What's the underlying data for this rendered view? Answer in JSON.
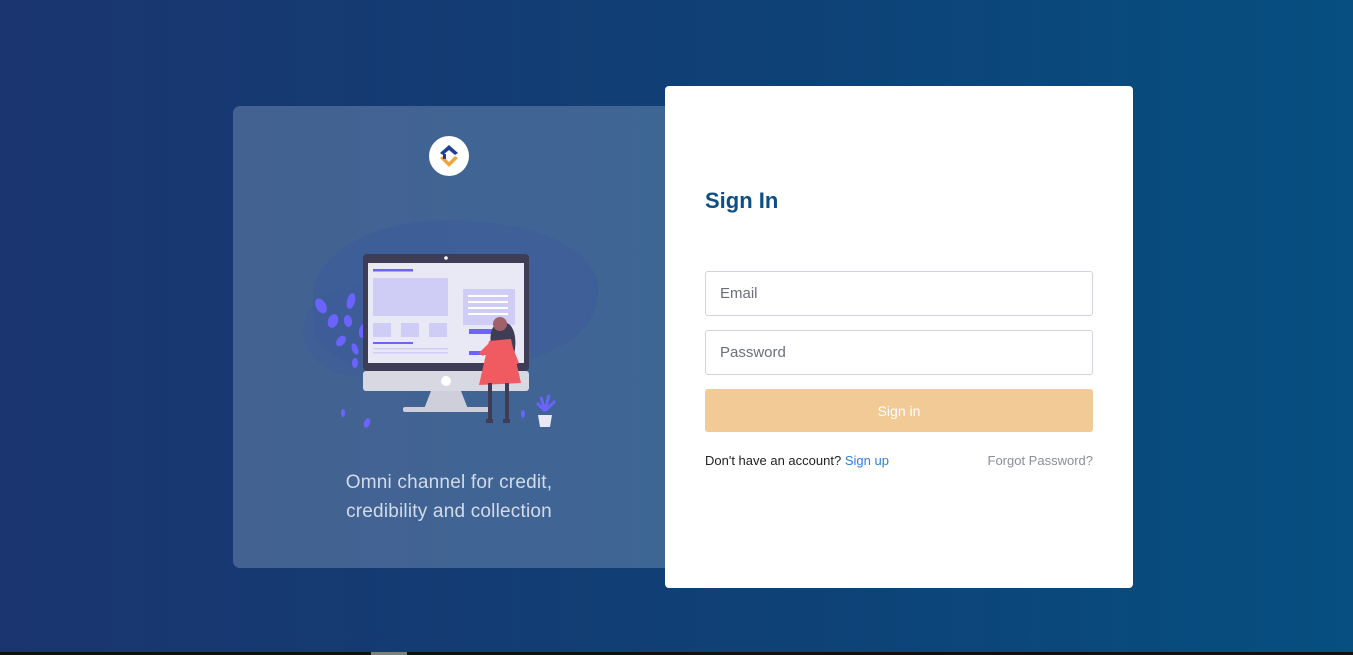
{
  "brand": {
    "logo_icon": "brand-logo-icon",
    "tagline_line1": "Omni channel for credit,",
    "tagline_line2": "credibility and collection",
    "colors": {
      "logo_blue": "#1f3f8f",
      "logo_orange": "#f0a53a"
    }
  },
  "form": {
    "title": "Sign In",
    "email_placeholder": "Email",
    "password_placeholder": "Password",
    "submit_label": "Sign in",
    "signup_prompt": "Don't have an account?",
    "signup_link": "Sign up",
    "forgot_link": "Forgot Password?"
  },
  "colors": {
    "background_start": "#1b3570",
    "background_end": "#064f80",
    "title": "#0d4f84",
    "button": "#f2ca96",
    "link": "#2f7fd8",
    "muted_link": "#8a8f96",
    "illustration_accent": "#6c63ff",
    "illustration_figure": "#f05b62"
  },
  "illustration": {
    "icon": "computer-presentation-illustration"
  }
}
